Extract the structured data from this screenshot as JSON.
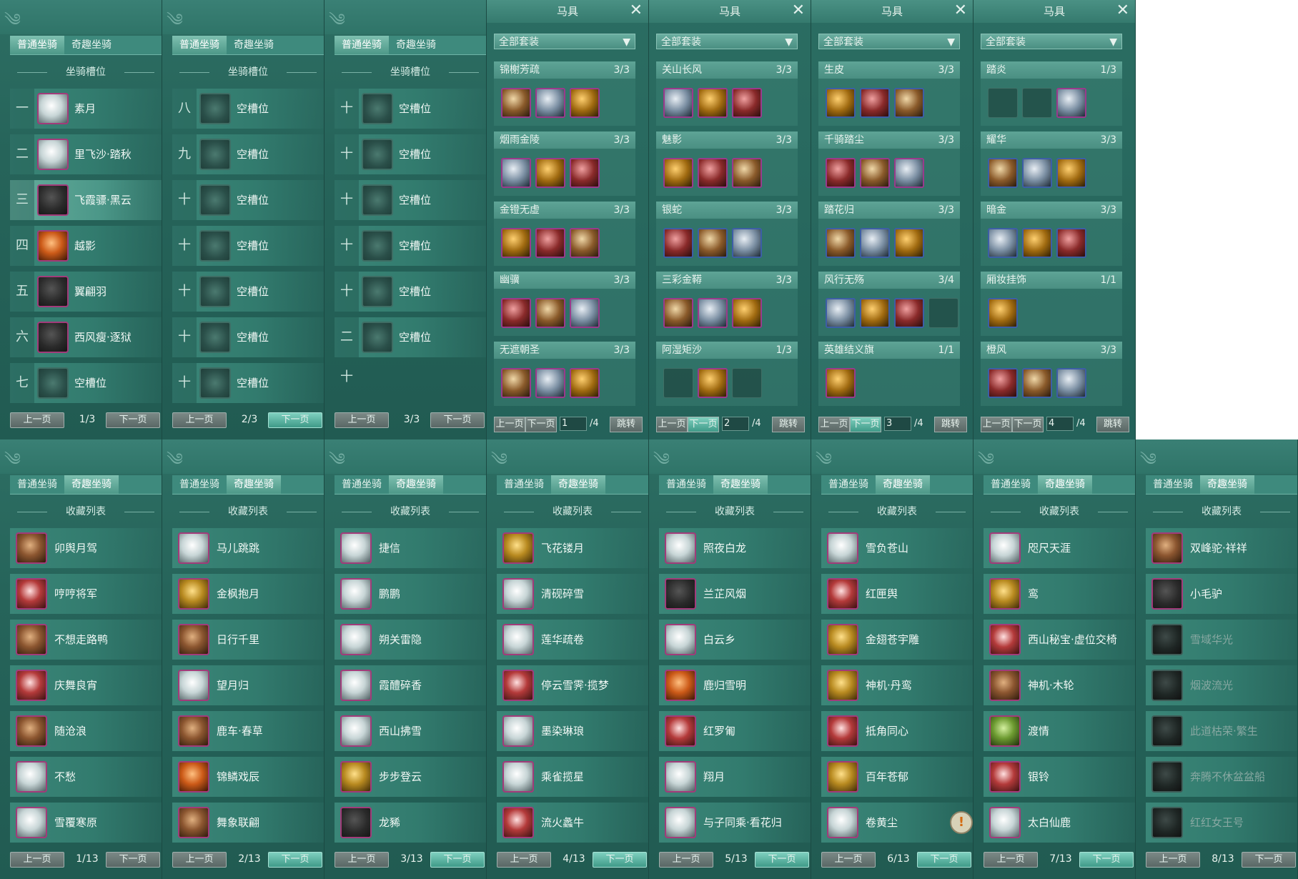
{
  "tabs": {
    "normal": "普通坐骑",
    "fun": "奇趣坐骑"
  },
  "labels": {
    "slots_title": "坐骑槽位",
    "collection_title": "收藏列表",
    "prev": "上一页",
    "next": "下一页",
    "empty_slot": "空槽位"
  },
  "slot_pages": [
    {
      "page": "1/3",
      "rows": [
        {
          "num": "一",
          "name": "素月",
          "icon": "white-horse-icon",
          "style": "white"
        },
        {
          "num": "二",
          "name": "里飞沙·踏秋",
          "icon": "white-horse-icon",
          "style": "white"
        },
        {
          "num": "三",
          "name": "飞霞骠·黑云",
          "icon": "black-horse-icon",
          "style": "dark",
          "selected": true
        },
        {
          "num": "四",
          "name": "越影",
          "icon": "brown-horse-icon",
          "style": "orange"
        },
        {
          "num": "五",
          "name": "翼翩羽",
          "icon": "black-horse-icon",
          "style": "dark"
        },
        {
          "num": "六",
          "name": "西风瘦·逐狱",
          "icon": "black-horse-icon",
          "style": "dark"
        },
        {
          "num": "七",
          "name": "空槽位",
          "icon": "empty-slot-icon",
          "style": "empty"
        }
      ]
    },
    {
      "page": "2/3",
      "rows": [
        {
          "num": "八",
          "name": "空槽位",
          "icon": "empty-slot-icon",
          "style": "empty"
        },
        {
          "num": "九",
          "name": "空槽位",
          "icon": "empty-slot-icon",
          "style": "empty"
        },
        {
          "num": "十",
          "name": "空槽位",
          "icon": "empty-slot-icon",
          "style": "empty"
        },
        {
          "num": "十一",
          "name": "空槽位",
          "icon": "empty-slot-icon",
          "style": "empty"
        },
        {
          "num": "十二",
          "name": "空槽位",
          "icon": "empty-slot-icon",
          "style": "empty"
        },
        {
          "num": "十三",
          "name": "空槽位",
          "icon": "empty-slot-icon",
          "style": "empty"
        },
        {
          "num": "十四",
          "name": "空槽位",
          "icon": "empty-slot-icon",
          "style": "empty"
        }
      ]
    },
    {
      "page": "3/3",
      "rows": [
        {
          "num": "十五",
          "name": "空槽位",
          "icon": "empty-slot-icon",
          "style": "empty"
        },
        {
          "num": "十六",
          "name": "空槽位",
          "icon": "empty-slot-icon",
          "style": "empty"
        },
        {
          "num": "十七",
          "name": "空槽位",
          "icon": "empty-slot-icon",
          "style": "empty"
        },
        {
          "num": "十八",
          "name": "空槽位",
          "icon": "empty-slot-icon",
          "style": "empty"
        },
        {
          "num": "十九",
          "name": "空槽位",
          "icon": "empty-slot-icon",
          "style": "empty"
        },
        {
          "num": "二十",
          "name": "空槽位",
          "icon": "empty-slot-icon",
          "style": "empty"
        }
      ]
    }
  ],
  "equipment": {
    "title": "马具",
    "filter": "全部套装",
    "jump": "跳转",
    "prev_short": "上一页",
    "next_short": "下一页",
    "pages": [
      {
        "input": "1",
        "total": "/4",
        "sets": [
          {
            "name": "锦榭芳疏",
            "count": "3/3",
            "slots": [
              "f",
              "f",
              "f"
            ]
          },
          {
            "name": "烟雨金陵",
            "count": "3/3",
            "slots": [
              "f",
              "f",
              "f"
            ]
          },
          {
            "name": "金镫无虚",
            "count": "3/3",
            "slots": [
              "f",
              "f",
              "f"
            ]
          },
          {
            "name": "幽骥",
            "count": "3/3",
            "slots": [
              "f",
              "f",
              "f"
            ]
          },
          {
            "name": "无遮朝圣",
            "count": "3/3",
            "slots": [
              "f",
              "f",
              "f"
            ]
          }
        ]
      },
      {
        "input": "2",
        "total": "/4",
        "sets": [
          {
            "name": "关山长风",
            "count": "3/3",
            "slots": [
              "f",
              "f",
              "f"
            ]
          },
          {
            "name": "魅影",
            "count": "3/3",
            "slots": [
              "f",
              "f",
              "f"
            ]
          },
          {
            "name": "银蛇",
            "count": "3/3",
            "slots": [
              "b",
              "b",
              "b"
            ]
          },
          {
            "name": "三彩金鞯",
            "count": "3/3",
            "slots": [
              "f",
              "f",
              "f"
            ]
          },
          {
            "name": "阿湿矩沙",
            "count": "1/3",
            "slots": [
              "e",
              "f",
              "e"
            ]
          }
        ]
      },
      {
        "input": "3",
        "total": "/4",
        "sets": [
          {
            "name": "生皮",
            "count": "3/3",
            "slots": [
              "b",
              "b",
              "b"
            ]
          },
          {
            "name": "千骑踏尘",
            "count": "3/3",
            "slots": [
              "f",
              "f",
              "f"
            ]
          },
          {
            "name": "踏花归",
            "count": "3/3",
            "slots": [
              "b",
              "b",
              "b"
            ]
          },
          {
            "name": "风行无殇",
            "count": "3/4",
            "slots": [
              "b",
              "b",
              "b",
              "e"
            ]
          },
          {
            "name": "英雄结义旗",
            "count": "1/1",
            "slots": [
              "f"
            ]
          }
        ]
      },
      {
        "input": "4",
        "total": "/4",
        "sets": [
          {
            "name": "踏炎",
            "count": "1/3",
            "slots": [
              "e",
              "e",
              "f"
            ]
          },
          {
            "name": "耀华",
            "count": "3/3",
            "slots": [
              "b",
              "b",
              "b"
            ]
          },
          {
            "name": "暗金",
            "count": "3/3",
            "slots": [
              "b",
              "b",
              "b"
            ]
          },
          {
            "name": "厢妆挂饰",
            "count": "1/1",
            "slots": [
              "b"
            ]
          },
          {
            "name": "橙风",
            "count": "3/3",
            "slots": [
              "b",
              "b",
              "b"
            ]
          }
        ]
      }
    ]
  },
  "collection_pages": [
    {
      "page": "1/13",
      "items": [
        {
          "name": "卯舆月驾",
          "style": "brown"
        },
        {
          "name": "哼哼将军",
          "style": "red"
        },
        {
          "name": "不想走路鸭",
          "style": "brown"
        },
        {
          "name": "庆舞良宵",
          "style": "red"
        },
        {
          "name": "随沧浪",
          "style": "brown"
        },
        {
          "name": "不愁",
          "style": "white"
        },
        {
          "name": "雪覆寒原",
          "style": "white"
        }
      ]
    },
    {
      "page": "2/13",
      "items": [
        {
          "name": "马儿跳跳",
          "style": "white"
        },
        {
          "name": "金枫抱月",
          "style": "gold"
        },
        {
          "name": "日行千里",
          "style": "brown"
        },
        {
          "name": "望月归",
          "style": "white"
        },
        {
          "name": "鹿车·春草",
          "style": "brown"
        },
        {
          "name": "锦鳞戏辰",
          "style": "orange"
        },
        {
          "name": "舞象联翩",
          "style": "brown"
        }
      ]
    },
    {
      "page": "3/13",
      "items": [
        {
          "name": "捷信",
          "style": "white"
        },
        {
          "name": "鹏鹏",
          "style": "white"
        },
        {
          "name": "朔关雷隐",
          "style": "white"
        },
        {
          "name": "霞醴碎香",
          "style": "white"
        },
        {
          "name": "西山拂雪",
          "style": "white"
        },
        {
          "name": "步步登云",
          "style": "gold"
        },
        {
          "name": "龙豨",
          "style": "dark"
        }
      ]
    },
    {
      "page": "4/13",
      "items": [
        {
          "name": "飞花镂月",
          "style": "gold"
        },
        {
          "name": "清砚碎雪",
          "style": "white"
        },
        {
          "name": "莲华疏卷",
          "style": "white"
        },
        {
          "name": "停云雪霁·揽梦",
          "style": "red"
        },
        {
          "name": "墨染琳琅",
          "style": "white"
        },
        {
          "name": "乘雀揽星",
          "style": "white"
        },
        {
          "name": "流火蠡牛",
          "style": "red"
        }
      ]
    },
    {
      "page": "5/13",
      "items": [
        {
          "name": "照夜白龙",
          "style": "white"
        },
        {
          "name": "兰芷风烟",
          "style": "dark"
        },
        {
          "name": "白云乡",
          "style": "white"
        },
        {
          "name": "鹿归雪明",
          "style": "orange"
        },
        {
          "name": "红罗匍",
          "style": "red"
        },
        {
          "name": "翔月",
          "style": "white"
        },
        {
          "name": "与子同乘·看花归",
          "style": "white"
        }
      ]
    },
    {
      "page": "6/13",
      "items": [
        {
          "name": "雪负苍山",
          "style": "white"
        },
        {
          "name": "红匣舆",
          "style": "red"
        },
        {
          "name": "金翅苍宇雕",
          "style": "gold"
        },
        {
          "name": "神机·丹鸾",
          "style": "gold"
        },
        {
          "name": "抵角同心",
          "style": "red"
        },
        {
          "name": "百年苍郁",
          "style": "gold"
        },
        {
          "name": "卷黄尘",
          "style": "white",
          "warn": true
        }
      ]
    },
    {
      "page": "7/13",
      "items": [
        {
          "name": "咫尺天涯",
          "style": "white"
        },
        {
          "name": "鸾",
          "style": "gold"
        },
        {
          "name": "西山秘宝·虚位交椅",
          "style": "red"
        },
        {
          "name": "神机·木轮",
          "style": "brown"
        },
        {
          "name": "渡情",
          "style": "green"
        },
        {
          "name": "银铃",
          "style": "red"
        },
        {
          "name": "太白仙鹿",
          "style": "white"
        }
      ]
    },
    {
      "page": "8/13",
      "items": [
        {
          "name": "双峰驼·祥祥",
          "style": "brown"
        },
        {
          "name": "小毛驴",
          "style": "dark"
        },
        {
          "name": "雪域华光",
          "style": "dim",
          "grey": true
        },
        {
          "name": "烟波流光",
          "style": "dim",
          "grey": true
        },
        {
          "name": "此道枯荣·繁生",
          "style": "dim",
          "grey": true
        },
        {
          "name": "奔腾不休盆盆船",
          "style": "dim",
          "grey": true
        },
        {
          "name": "红红女王号",
          "style": "dim",
          "grey": true
        }
      ]
    }
  ],
  "colors": {
    "teal_bg": "#26645a",
    "row": "#3b8678",
    "accent": "#7fd0bf",
    "rare_border": "#a23b7a"
  }
}
